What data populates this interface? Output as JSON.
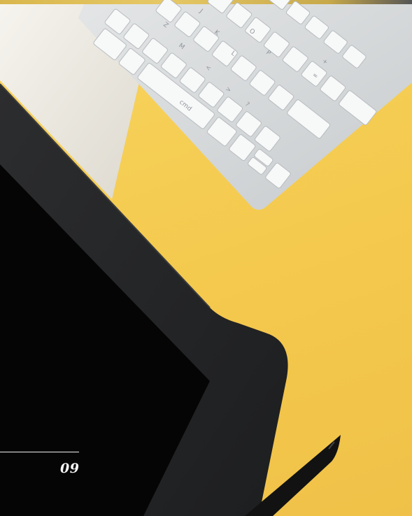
{
  "page": {
    "number": "09"
  },
  "photo": {
    "background_color": "#f4c94d",
    "objects": [
      "keyboard",
      "pen-tablet",
      "stylus-pen"
    ],
    "keyboard_legends": [
      "Z",
      "M",
      "J",
      "K",
      "O",
      "P",
      "L",
      "cmd",
      "?",
      "<",
      ">",
      "+",
      "="
    ]
  }
}
